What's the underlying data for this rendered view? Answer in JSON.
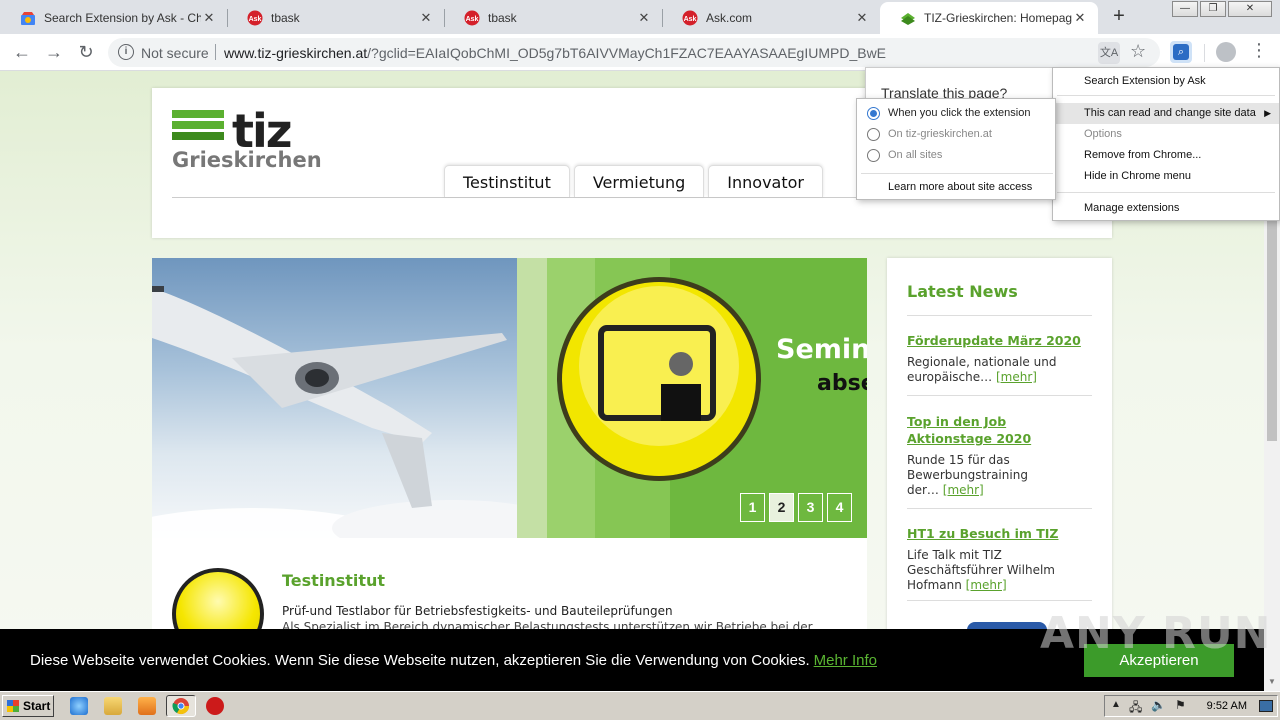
{
  "browser": {
    "tabs": [
      {
        "title": "Search Extension by Ask - Chro",
        "favicon": "chrome-web-store-icon",
        "active": false
      },
      {
        "title": "tbask",
        "favicon": "ask-icon",
        "active": false
      },
      {
        "title": "tbask",
        "favicon": "ask-icon",
        "active": false
      },
      {
        "title": "Ask.com",
        "favicon": "ask-icon",
        "active": false
      },
      {
        "title": "TIZ-Grieskirchen: Homepage",
        "favicon": "tiz-icon",
        "active": true
      }
    ],
    "new_tab": "+",
    "window_buttons": {
      "minimize": "—",
      "restore": "❐",
      "close": "✕"
    },
    "omnibox": {
      "security": "Not secure",
      "url_domain": "www.tiz-grieskirchen.at",
      "url_rest": "/?gclid=EAIaIQobChMI_OD5g7bT6AIVVMayCh1FZAC7EAAYASAAEgIUMPD_BwE"
    }
  },
  "site": {
    "logo": {
      "brand": "tiz",
      "sub": "Grieskirchen"
    },
    "nav": [
      "Testinstitut",
      "Vermietung",
      "Innovator"
    ],
    "slider": {
      "heading": "Semina",
      "subheading": "abse",
      "pages": [
        "1",
        "2",
        "3",
        "4"
      ],
      "active_page": "2"
    },
    "section": {
      "title": "Testinstitut",
      "subtitle": "Prüf-und Testlabor für Betriebsfestigkeits- und Bauteileprüfungen",
      "text": "Als Spezialist im Bereich dynamischer Belastungstests unterstützen wir Betriebe bei der"
    },
    "news": {
      "heading": "Latest News",
      "items": [
        {
          "title": "Förderupdate März 2020",
          "text": "Regionale, nationale und europäische…",
          "more": "[mehr]"
        },
        {
          "title": "Top in den Job Aktionstage 2020",
          "text": "Runde 15 für das Bewerbungstraining der…",
          "more": "[mehr]"
        },
        {
          "title": "HT1 zu Besuch im TIZ",
          "text": "Life Talk mit TIZ Geschäftsführer Wilhelm Hofmann",
          "more": "[mehr]"
        }
      ]
    },
    "cookie": {
      "message": "Diese Webseite verwendet Cookies. Wenn Sie diese Webseite nutzen, akzeptieren Sie die Verwendung von Cookies.",
      "link": "Mehr Info",
      "button": "Akzeptieren"
    }
  },
  "translate_popup": {
    "text": "Translate this page?"
  },
  "extension_menu": {
    "items": [
      {
        "label": "Search Extension by Ask",
        "state": "normal"
      },
      {
        "label": "This can read and change site data",
        "state": "highlighted",
        "submenu": true
      },
      {
        "label": "Options",
        "state": "disabled"
      },
      {
        "label": "Remove from Chrome...",
        "state": "normal"
      },
      {
        "label": "Hide in Chrome menu",
        "state": "normal"
      },
      {
        "label": "Manage extensions",
        "state": "normal"
      }
    ],
    "submenu": {
      "options": [
        {
          "label": "When you click the extension",
          "selected": true
        },
        {
          "label": "On tiz-grieskirchen.at",
          "selected": false
        },
        {
          "label": "On all sites",
          "selected": false
        }
      ],
      "learn_more": "Learn more about site access"
    }
  },
  "watermark": "ANY RUN",
  "taskbar": {
    "start": "Start",
    "clock": "9:52 AM"
  },
  "colors": {
    "tiz_green": "#5aa22d",
    "cookie_button": "#3c9b2a",
    "chrome_tabstrip": "#dee1e6"
  }
}
